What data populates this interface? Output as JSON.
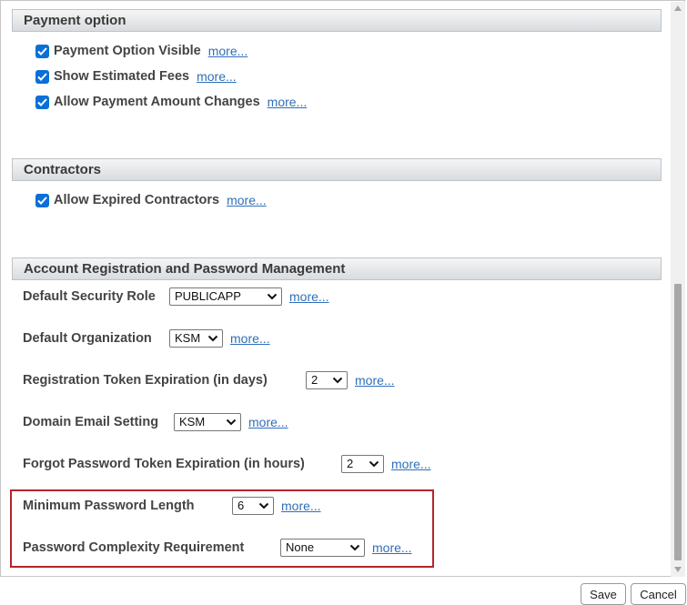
{
  "sections": {
    "payment": {
      "title": "Payment option",
      "items": [
        {
          "label": "Payment Option Visible",
          "more": "more..."
        },
        {
          "label": "Show Estimated Fees",
          "more": "more..."
        },
        {
          "label": "Allow Payment Amount Changes",
          "more": "more..."
        }
      ]
    },
    "contractors": {
      "title": "Contractors",
      "items": [
        {
          "label": "Allow Expired Contractors",
          "more": "more..."
        }
      ]
    },
    "account": {
      "title": "Account Registration and Password Management",
      "fields": [
        {
          "label": "Default Security Role",
          "value": "PUBLICAPP",
          "more": "more..."
        },
        {
          "label": "Default Organization",
          "value": "KSM",
          "more": "more..."
        },
        {
          "label": "Registration Token Expiration (in days)",
          "value": "2",
          "more": "more..."
        },
        {
          "label": "Domain Email Setting",
          "value": "KSM",
          "more": "more..."
        },
        {
          "label": "Forgot Password Token Expiration (in hours)",
          "value": "2",
          "more": "more..."
        },
        {
          "label": "Minimum Password Length",
          "value": "6",
          "more": "more..."
        },
        {
          "label": "Password Complexity Requirement",
          "value": "None",
          "more": "more..."
        }
      ]
    }
  },
  "buttons": {
    "save": "Save",
    "cancel": "Cancel"
  },
  "colors": {
    "accent": "#0a6fd6",
    "link": "#2f6fb8",
    "highlight_border": "#b3262b"
  }
}
